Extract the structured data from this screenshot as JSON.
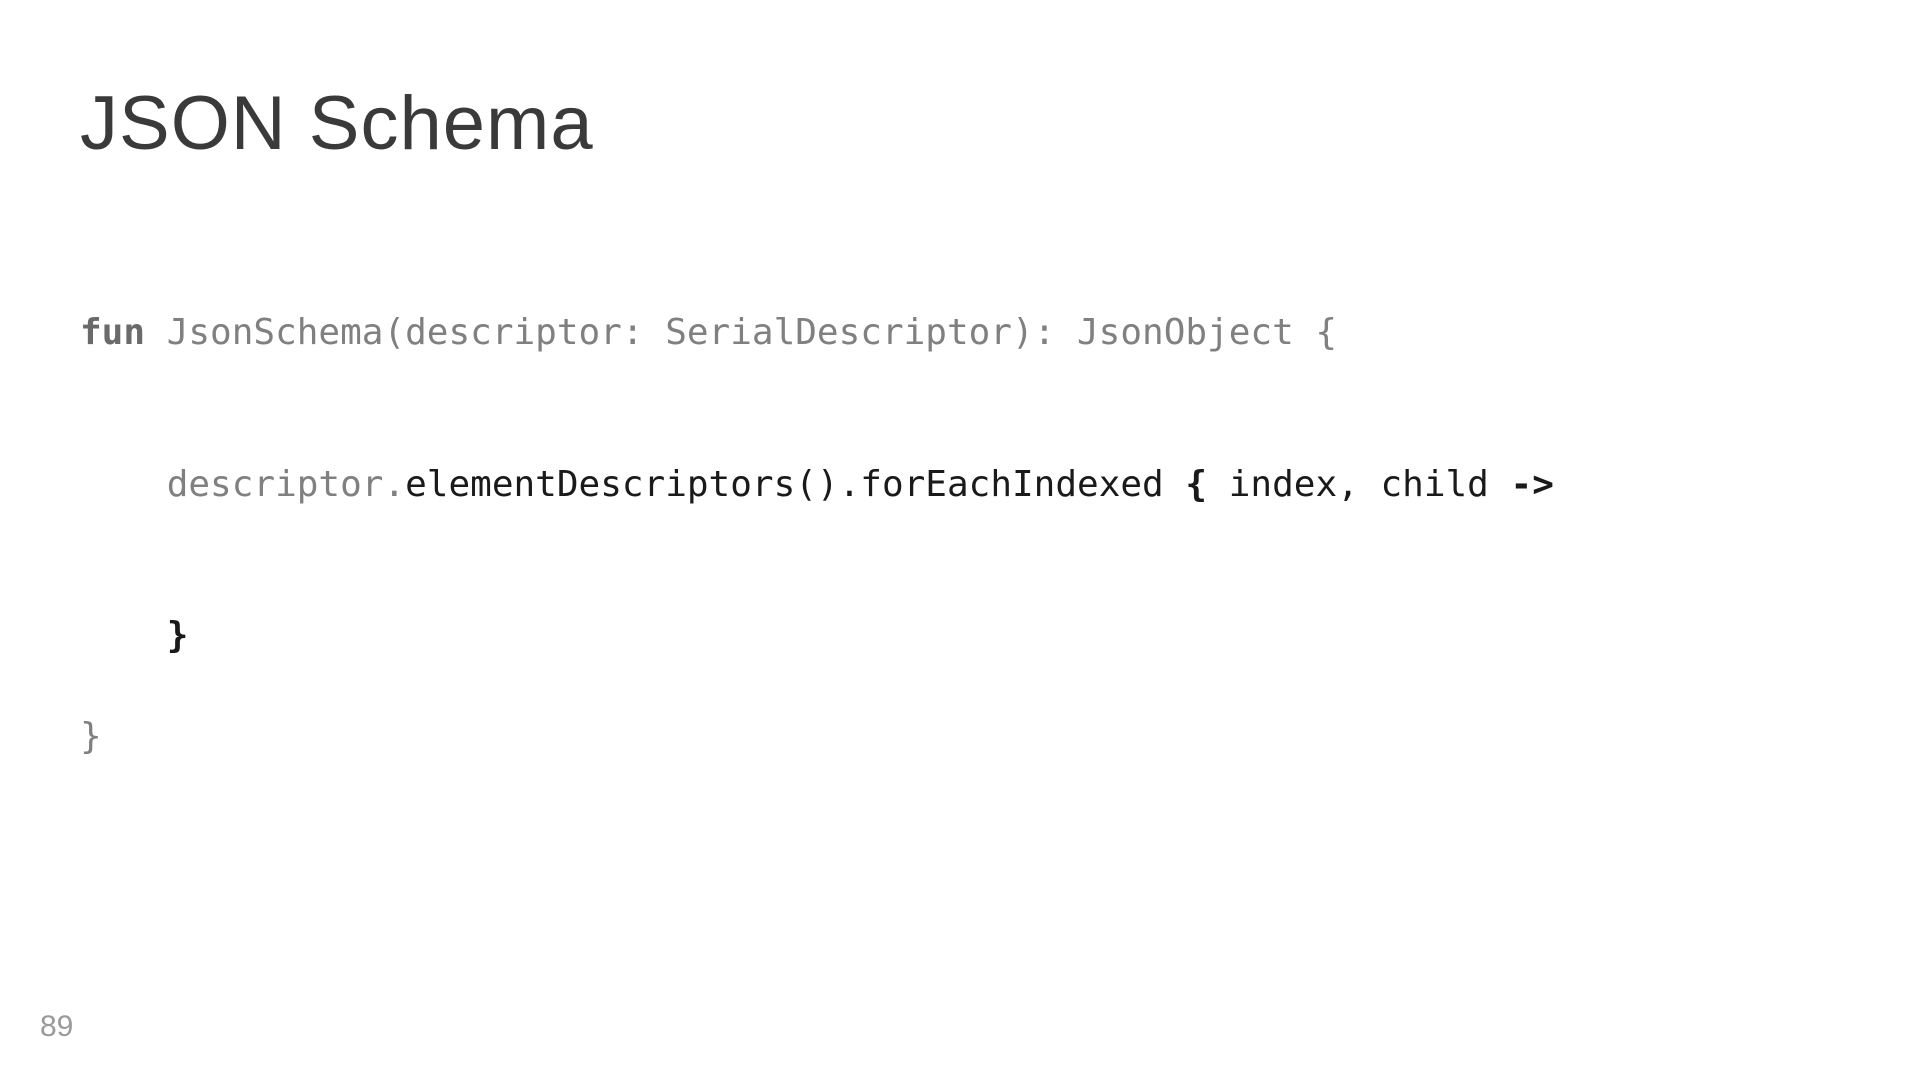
{
  "title": "JSON Schema",
  "code": {
    "line1": {
      "keyword": "fun",
      "rest": " JsonSchema(descriptor: SerialDescriptor): JsonObject {"
    },
    "line2": "",
    "line3": {
      "indent": "    ",
      "dim": "descriptor.",
      "call": "elementDescriptors().forEachIndexed ",
      "bold1": "{",
      "params": " index, child ",
      "bold2": "->"
    },
    "line4": "",
    "line5": {
      "indent": "    ",
      "close": "}"
    },
    "line6": "}"
  },
  "page_number": "89"
}
